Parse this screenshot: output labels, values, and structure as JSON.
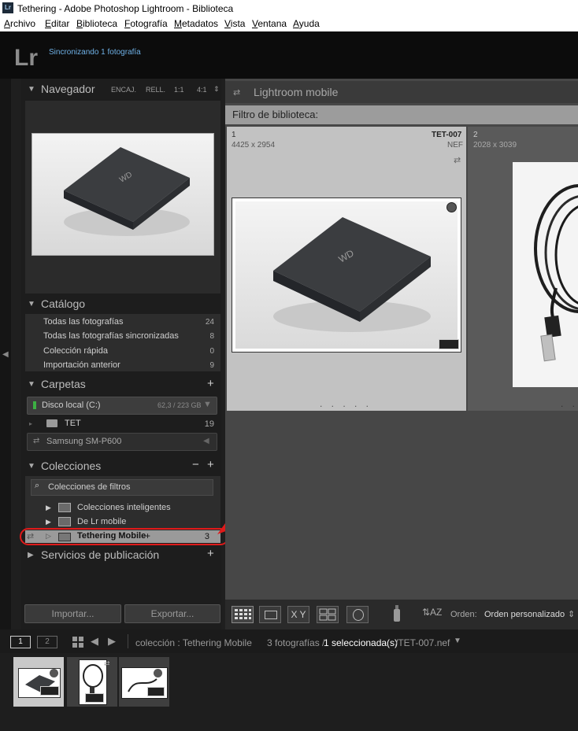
{
  "window": {
    "title": "Tethering - Adobe Photoshop Lightroom - Biblioteca"
  },
  "menu": [
    "Archivo",
    "Editar",
    "Biblioteca",
    "Fotografía",
    "Metadatos",
    "Vista",
    "Ventana",
    "Ayuda"
  ],
  "identity": {
    "logo": "Lr",
    "sync_status": "Sincronizando 1 fotografía"
  },
  "navigator": {
    "title": "Navegador",
    "zoom": [
      "ENCAJ.",
      "RELL.",
      "1:1",
      "4:1"
    ]
  },
  "catalog": {
    "title": "Catálogo",
    "items": [
      {
        "label": "Todas las fotografías",
        "count": "24"
      },
      {
        "label": "Todas las fotografías sincronizadas",
        "count": "8"
      },
      {
        "label": "Colección rápida",
        "count": "0"
      },
      {
        "label": "Importación anterior",
        "count": "9"
      }
    ]
  },
  "folders": {
    "title": "Carpetas",
    "add": "+",
    "volumes": [
      {
        "label": "Disco local (C:)",
        "size": "62,3 / 223 GB"
      },
      {
        "label": "Samsung SM-P600"
      }
    ],
    "folder": {
      "label": "TET",
      "count": "19"
    }
  },
  "collections": {
    "title": "Colecciones",
    "minus": "−",
    "plus": "+",
    "filter_placeholder": "Colecciones de filtros",
    "items": [
      {
        "label": "Colecciones inteligentes"
      },
      {
        "label": "De Lr mobile"
      },
      {
        "label": "Tethering Mobile",
        "suffix": "+",
        "count": "3"
      }
    ]
  },
  "publish": {
    "title": "Servicios de publicación",
    "plus": "+"
  },
  "buttons": {
    "import": "Importar...",
    "export": "Exportar..."
  },
  "main": {
    "source": "Lightroom mobile",
    "filter_bar": "Filtro de biblioteca:",
    "cells": [
      {
        "index": "1",
        "name": "TET-007",
        "dims": "4425 x 2954",
        "ext": "NEF",
        "dots": ". . . . ."
      },
      {
        "index": "2",
        "dims": "2028 x 3039",
        "dots": ". ."
      }
    ]
  },
  "toolbar": {
    "sort_label": "Orden:",
    "sort_value": "Orden personalizado",
    "sort_arrow": "⇕",
    "xy_label": "X Y"
  },
  "filmstrip": {
    "page1": "1",
    "page2": "2",
    "collection": "colección : Tethering Mobile",
    "count_text": "3 fotografías /",
    "selected": "1 seleccionada(s)",
    "file": "/TET-007.nef"
  },
  "colors": {
    "accent_blue": "#6fb1e6",
    "annotation_red": "#e01a1a"
  }
}
